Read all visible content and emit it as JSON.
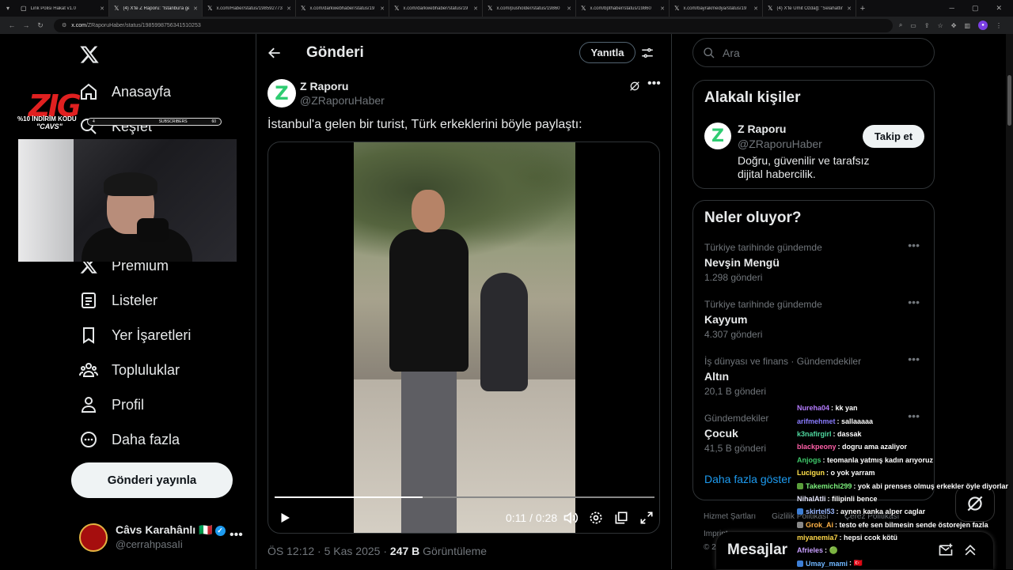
{
  "browser": {
    "tabs": [
      {
        "title": "Link Polisi Hakat v1.0",
        "icon": "generic-page-icon",
        "active": false
      },
      {
        "title": "(4) X'te Z Raporu: \"İstanbul'a gelen bir turist",
        "icon": "x-logo-icon",
        "active": true
      },
      {
        "title": "x.com/Haber/status/1985927733",
        "icon": "x-logo-icon",
        "active": false
      },
      {
        "title": "x.com/darkwebhaber/status/19",
        "icon": "x-logo-icon",
        "active": false
      },
      {
        "title": "x.com/darkwebhaber/status/19",
        "icon": "x-logo-icon",
        "active": false
      },
      {
        "title": "x.com/pusholder/status/19860",
        "icon": "x-logo-icon",
        "active": false
      },
      {
        "title": "x.com/bpthaber/status/19860",
        "icon": "x-logo-icon",
        "active": false
      },
      {
        "title": "x.com/bayrakmedya/status/19",
        "icon": "x-logo-icon",
        "active": false
      },
      {
        "title": "(4) X'te Ümit Özdağ: \"Selahattin",
        "icon": "x-logo-icon",
        "active": false
      }
    ],
    "url_host": "x.com",
    "url_path": "/ZRaporuHaber/status/1985998756341510253"
  },
  "nav": {
    "items": [
      {
        "label": "Anasayfa",
        "icon": "home-icon"
      },
      {
        "label": "Keşfet",
        "icon": "search-icon"
      },
      {
        "label": "Premium",
        "icon": "x-premium-icon"
      },
      {
        "label": "Listeler",
        "icon": "list-icon"
      },
      {
        "label": "Yer İşaretleri",
        "icon": "bookmark-icon"
      },
      {
        "label": "Topluluklar",
        "icon": "communities-icon"
      },
      {
        "label": "Profil",
        "icon": "profile-icon"
      },
      {
        "label": "Daha fazla",
        "icon": "more-circle-icon"
      }
    ],
    "post_button": "Gönderi yayınla"
  },
  "account": {
    "name": "Câvs Karahânlı",
    "flag": "🇮🇹",
    "handle": "@cerrahpasaIi"
  },
  "overlay": {
    "logo_text": "ZIG",
    "promo": "%10 İNDİRİM KODU",
    "code": "\"CAVS\"",
    "sub_left": "4",
    "sub_label": "SUBSCRIBERS",
    "sub_right": "60"
  },
  "post": {
    "header_title": "Gönderi",
    "reply_label": "Yanıtla",
    "author_name": "Z Raporu",
    "author_handle": "@ZRaporuHaber",
    "avatar_letter": "Z",
    "text": "İstanbul'a gelen bir turist, Türk erkeklerini böyle paylaştı:",
    "video_time": "0:11 / 0:28",
    "video_progress": 0.39,
    "time": "ÖS 12:12",
    "date": "5 Kas 2025",
    "views": "247 B",
    "views_label": "Görüntüleme"
  },
  "sidebar": {
    "search_placeholder": "Ara",
    "related_title": "Alakalı kişiler",
    "related": {
      "name": "Z Raporu",
      "handle": "@ZRaporuHaber",
      "bio": "Doğru, güvenilir ve tarafsız dijital habercilik.",
      "follow_label": "Takip et",
      "avatar_letter": "Z"
    },
    "trends_title": "Neler oluyor?",
    "trends": [
      {
        "context": "Türkiye tarihinde gündemde",
        "name": "Nevşin Mengü",
        "count": "1.298 gönderi"
      },
      {
        "context": "Türkiye tarihinde gündemde",
        "name": "Kayyum",
        "count": "4.307 gönderi"
      },
      {
        "context": "İş dünyası ve finans · Gündemdekiler",
        "name": "Altın",
        "count": "20,1 B gönderi"
      },
      {
        "context": "Gündemdekiler",
        "name": "Çocuk",
        "count": "41,5 B gönderi"
      }
    ],
    "show_more": "Daha fazla göster",
    "footer_links": [
      "Hizmet Şartları",
      "Gizlilik Politikası",
      "Çerez Politikası"
    ],
    "footer_line2": "Imprint",
    "footer_line3": "© 2"
  },
  "messages": {
    "title": "Mesajlar"
  },
  "chat": [
    {
      "user": "Nureha04",
      "msg": ": kk yan",
      "color": "#b57cff",
      "badge": ""
    },
    {
      "user": "arifmehmet",
      "msg": ": sallaaaaa",
      "color": "#8a7cff",
      "badge": ""
    },
    {
      "user": "k3nafirgirl",
      "msg": ": dassak",
      "color": "#4fd8a0",
      "badge": ""
    },
    {
      "user": "blackpeony",
      "msg": ": dogru ama azaliyor",
      "color": "#ff5fa8",
      "badge": ""
    },
    {
      "user": "Anjogs",
      "msg": ": teomanla yatmış kadın arıyoruz",
      "color": "#3fc96a",
      "badge": ""
    },
    {
      "user": "Lucigun",
      "msg": ": o yok yarram",
      "color": "#ffe14a",
      "badge": ""
    },
    {
      "user": "Takemichi299",
      "msg": ": yok abi prenses olmuş erkekler öyle diyorlar",
      "color": "#7cf07c",
      "badge": "#5a9e3a"
    },
    {
      "user": "NihalAtli",
      "msg": ": filipinli bence",
      "color": "#e9e9ff",
      "badge": ""
    },
    {
      "user": "skirtel53",
      "msg": ": aynen kanka alper caglar",
      "color": "#9ab8ff",
      "badge": "#3d7fd6"
    },
    {
      "user": "Grok_Ai",
      "msg": ": testo efe sen bilmesin sende östorejen fazla",
      "color": "#ffb347",
      "badge": "#888"
    },
    {
      "user": "miyanemia7",
      "msg": ": hepsi ccok kötü",
      "color": "#ffd84a",
      "badge": ""
    },
    {
      "user": "Afrieles",
      "msg": ": 🟢",
      "color": "#c9a0ff",
      "badge": ""
    },
    {
      "user": "Umay_mami",
      "msg": ": 🇹🇷",
      "color": "#6fb6ff",
      "badge": "#3d7fd6"
    }
  ]
}
